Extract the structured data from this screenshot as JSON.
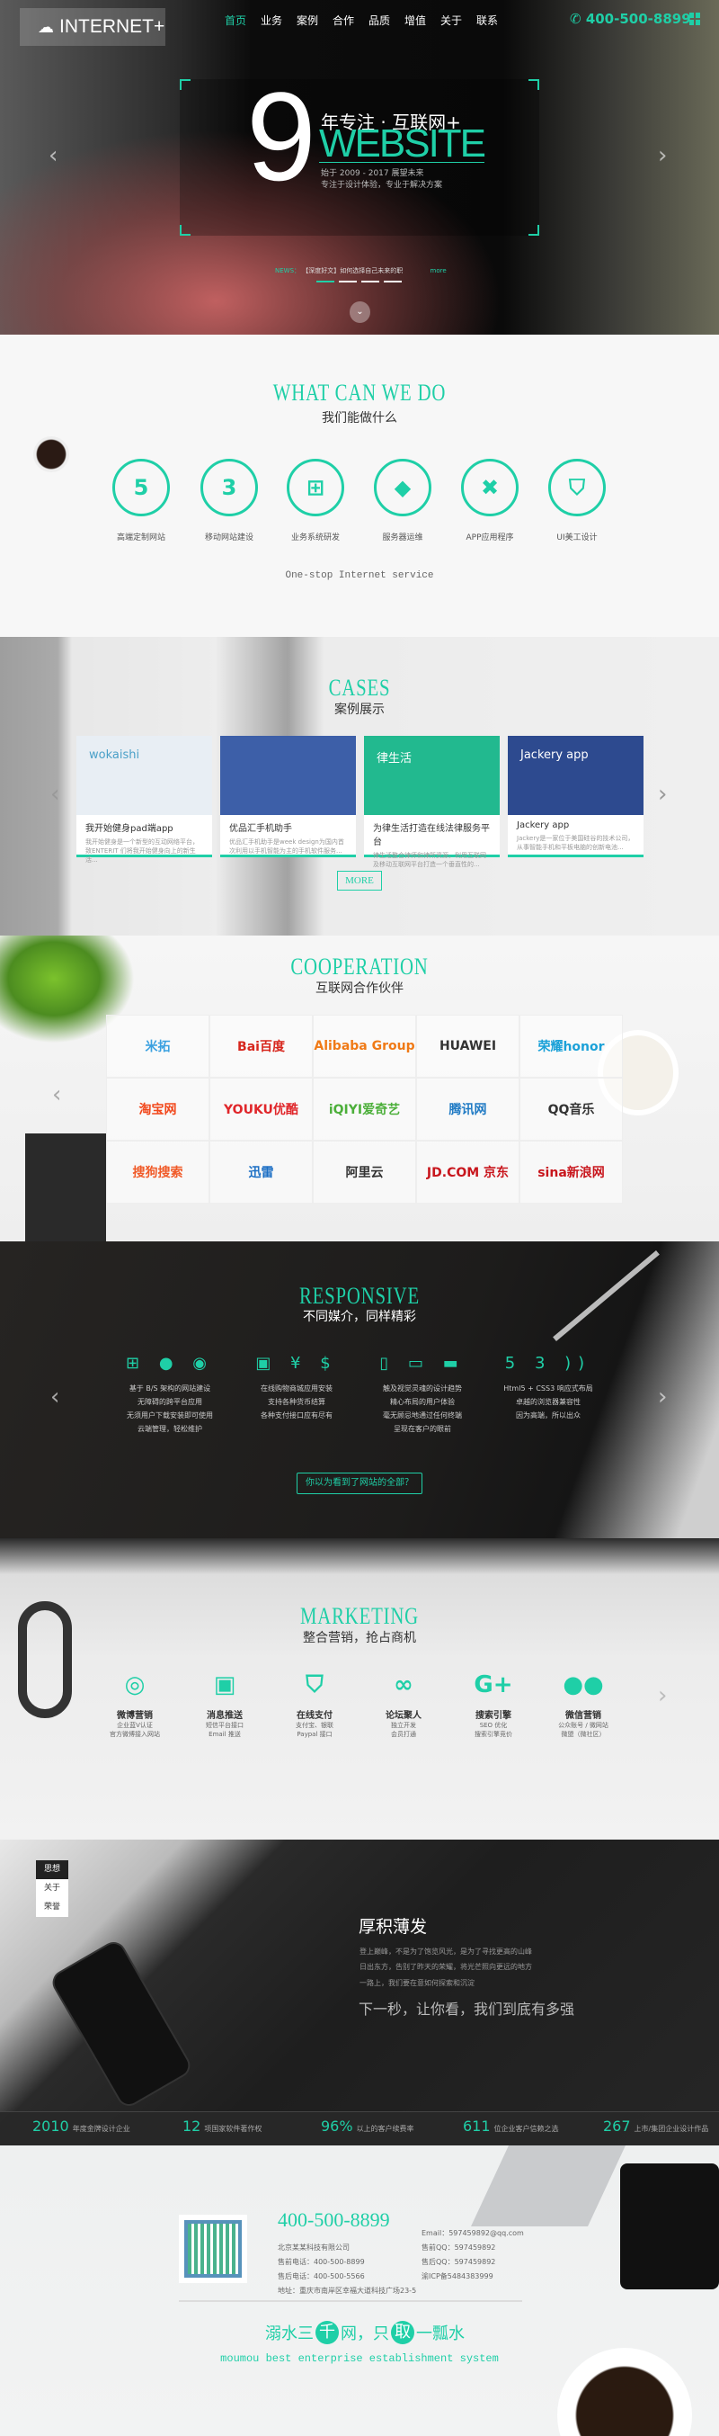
{
  "colors": {
    "accent": "#1fcfa7",
    "dark": "#1e1e1e"
  },
  "header": {
    "logo": "INTERNET+",
    "logo_icon": "cloud-icon",
    "nav": [
      "首页",
      "业务",
      "案例",
      "合作",
      "品质",
      "增值",
      "关于",
      "联系"
    ],
    "active_nav": 0,
    "phone": "400-500-8899",
    "phone_icon": "phone-icon",
    "menu_icon": "grid-icon"
  },
  "hero": {
    "big_number": "9",
    "headline": "年专注 · 互联网+",
    "word": "WEBSITE",
    "line1": "始于 2009 - 2017 展望未来",
    "line2": "专注于设计体验，专业于解决方案",
    "news_label": "NEWS：",
    "news_text": "【深度好文】如何选择自己未来的职",
    "news_more": "more",
    "slides": 4,
    "active_slide": 0
  },
  "services": {
    "title": "WHAT CAN WE DO",
    "subtitle": "我们能做什么",
    "items": [
      {
        "label": "高端定制网站",
        "icon": "html5-icon",
        "glyph": "5"
      },
      {
        "label": "移动网站建设",
        "icon": "css3-icon",
        "glyph": "3"
      },
      {
        "label": "业务系统研发",
        "icon": "sitemap-icon",
        "glyph": "⊞"
      },
      {
        "label": "服务器运维",
        "icon": "dropbox-icon",
        "glyph": "◆"
      },
      {
        "label": "APP应用程序",
        "icon": "joomla-icon",
        "glyph": "✖"
      },
      {
        "label": "UI美工设计",
        "icon": "shield-icon",
        "glyph": "⛉"
      }
    ],
    "tagline": "One-stop Internet service"
  },
  "cases": {
    "title": "CASES",
    "subtitle": "案例展示",
    "items": [
      {
        "title": "我开始健身pad端app",
        "desc": "我开始健身是一个新型的互动网络平台，致ENTERIT 们将我开始健身向上的新生活...",
        "thumb": "wokaishi",
        "color": "#e8eef4"
      },
      {
        "title": "优品汇手机助手",
        "desc": "优品汇手机助手是week design为国内首次利用以手机智能为主的手机软件服务...",
        "thumb": "",
        "color": "#3d5fa8"
      },
      {
        "title": "为律生活打造在线法律服务平台",
        "desc": "律生活整合律师和律所资源，利用互联网及移动互联网平台打造一个垂直性的...",
        "thumb": "律生活",
        "color": "#22b98f"
      },
      {
        "title": "Jackery app",
        "desc": "Jackery是一家位于美国硅谷的技术公司，从事智能手机和平板电脑的创新电池...",
        "thumb": "Jackery app",
        "color": "#2d4a8f"
      }
    ],
    "more": "MORE"
  },
  "cooperation": {
    "title": "COOPERATION",
    "subtitle": "互联网合作伙伴",
    "partners": [
      {
        "name": "米拓",
        "color": "#3aa0e0"
      },
      {
        "name": "Bai百度",
        "color": "#d7261d"
      },
      {
        "name": "Alibaba Group",
        "color": "#f07a16"
      },
      {
        "name": "HUAWEI",
        "color": "#333"
      },
      {
        "name": "荣耀honor",
        "color": "#1ba1d8"
      },
      {
        "name": "淘宝网",
        "color": "#f2481c"
      },
      {
        "name": "YOUKU优酷",
        "color": "#e0262a"
      },
      {
        "name": "iQIYI爱奇艺",
        "color": "#4caf3a"
      },
      {
        "name": "腾讯网",
        "color": "#1f7ac4"
      },
      {
        "name": "QQ音乐",
        "color": "#333"
      },
      {
        "name": "搜狗搜索",
        "color": "#f05a28"
      },
      {
        "name": "迅雷",
        "color": "#1c6fc4"
      },
      {
        "name": "阿里云",
        "color": "#333"
      },
      {
        "name": "JD.COM 京东",
        "color": "#c8161d"
      },
      {
        "name": "sina新浪网",
        "color": "#c8161d"
      }
    ]
  },
  "responsive": {
    "title": "RESPONSIVE",
    "subtitle": "不同媒介，同样精彩",
    "columns": [
      {
        "icons": "⊞  ●  ◉",
        "icon_names": [
          "windows-icon",
          "apple-icon",
          "android-icon"
        ],
        "lines": [
          "基于 B/S 架构的网站建设",
          "无障碍的跨平台应用",
          "无须用户下载安装即可使用",
          "云端管理，轻松维护"
        ]
      },
      {
        "icons": "▣  ¥  $",
        "icon_names": [
          "money-icon",
          "yen-icon",
          "dollar-icon"
        ],
        "lines": [
          "在线购物商城应用安装",
          "支持各种货币结算",
          "各种支付接口应有尽有"
        ]
      },
      {
        "icons": "▯  ▭  ▬",
        "icon_names": [
          "mobile-icon",
          "tablet-icon",
          "desktop-icon"
        ],
        "lines": [
          "触及视觉灵魂的设计趋势",
          "精心布局的用户体验",
          "毫无顾忌地通过任何终端",
          "呈现在客户的眼前"
        ]
      },
      {
        "icons": "5  3  ))",
        "icon_names": [
          "html5-icon",
          "css3-icon",
          "rss-icon"
        ],
        "lines": [
          "Html5 + CSS3 响应式布局",
          "卓越的浏览器兼容性",
          "因为高端，所以出众"
        ]
      }
    ],
    "button": "你以为看到了网站的全部？"
  },
  "marketing": {
    "title": "MARKETING",
    "subtitle": "整合营销，抢占商机",
    "items": [
      {
        "icon": "weibo-icon",
        "glyph": "◎",
        "title": "微博营销",
        "lines": [
          "企业蓝V认证",
          "官方微博接入网站"
        ]
      },
      {
        "icon": "twitch-icon",
        "glyph": "▣",
        "title": "消息推送",
        "lines": [
          "短信平台接口",
          "Email 推送"
        ]
      },
      {
        "icon": "shield-icon",
        "glyph": "⛉",
        "title": "在线支付",
        "lines": [
          "支付宝、银联",
          "Paypal 接口"
        ]
      },
      {
        "icon": "cloud-icon",
        "glyph": "∞",
        "title": "论坛聚人",
        "lines": [
          "独立开发",
          "会员打通"
        ]
      },
      {
        "icon": "google-plus-icon",
        "glyph": "G+",
        "title": "搜索引擎",
        "lines": [
          "SEO 优化",
          "搜索引擎竞价"
        ]
      },
      {
        "icon": "wechat-icon",
        "glyph": "●●",
        "title": "微信营销",
        "lines": [
          "公众账号 / 微网站",
          "微盟（微社区）"
        ]
      }
    ]
  },
  "about": {
    "tabs": [
      "思想",
      "关于",
      "荣誉"
    ],
    "active_tab": 0,
    "heading": "厚积薄发",
    "paragraphs": [
      "登上巅峰，不是为了饱览风光，是为了寻找更高的山峰",
      "日出东方，告别了昨天的荣耀，将光芒照向更远的地方",
      "一路上，我们要在意如何探索和沉淀"
    ],
    "slogan": "下一秒，让你看，我们到底有多强",
    "stats": [
      {
        "num": "2010",
        "label": "年度金牌设计企业"
      },
      {
        "num": "12",
        "label": "项国家软件著作权"
      },
      {
        "num": "96%",
        "label": "以上的客户续费率"
      },
      {
        "num": "611",
        "label": "位企业客户信赖之选"
      },
      {
        "num": "267",
        "label": "上市/集团企业设计作品"
      }
    ]
  },
  "footer": {
    "qr_icon": "wechat-qr-code",
    "phone": "400-500-8899",
    "company": "北京某某科技有限公司",
    "left": [
      "售前电话：400-500-8899",
      "售后电话：400-500-5566",
      "地址：重庆市南岸区幸福大道科技广场23-5"
    ],
    "right": [
      "Email：597459892@qq.com",
      "售前QQ：597459892",
      "售后QQ：597459892",
      "渝ICP备5484383999"
    ],
    "motto": [
      "溺水三",
      "千",
      "网，只",
      "取",
      "一瓢水"
    ],
    "english": "moumou best enterprise establishment system"
  }
}
